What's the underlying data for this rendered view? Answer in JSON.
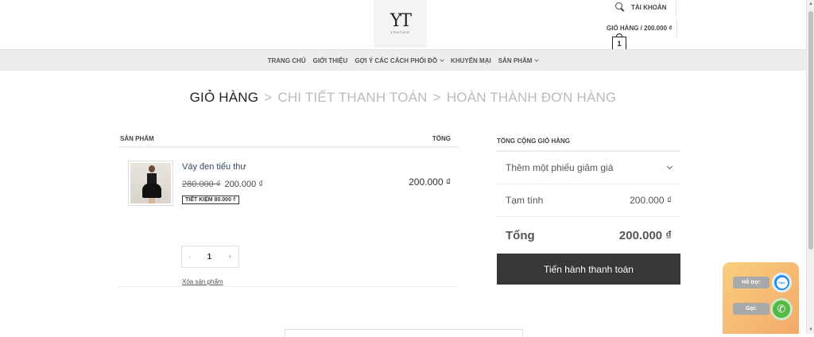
{
  "header": {
    "logo_mark": "YT",
    "logo_sub": "YOUTHIE",
    "account_label": "TÀI KHOẢN",
    "cart_label": "GIỎ HÀNG / 200.000 ₫",
    "cart_count": "1"
  },
  "nav": {
    "items": [
      {
        "label": "TRANG CHỦ"
      },
      {
        "label": "GIỚI THIỆU"
      },
      {
        "label": "GỢI Ý CÁC CÁCH PHỐI ĐỒ"
      },
      {
        "label": "KHUYẾN MẠI"
      },
      {
        "label": "SẢN PHẨM"
      }
    ]
  },
  "steps": {
    "cart": "GIỎ HÀNG",
    "checkout": "CHI TIẾT THANH TOÁN",
    "complete": "HOÀN THÀNH ĐƠN HÀNG",
    "separator": ">"
  },
  "cart": {
    "col_product": "SẢN PHẨM",
    "col_total": "TỔNG",
    "items": [
      {
        "name": "Váy đen tiểu thư",
        "old_price": "280.000 ₫",
        "price": "200.000 ₫",
        "saving": "TIẾT KIỆM 80.000 ₫",
        "line_total": "200.000 ₫",
        "quantity": "1",
        "minus": "-",
        "plus": "+",
        "remove": "Xóa sản phẩm"
      }
    ]
  },
  "totals": {
    "title": "TỔNG CỘNG GIỎ HÀNG",
    "coupon": "Thêm một phiếu giảm giá",
    "subtotal_label": "Tạm tính",
    "subtotal_value": "200.000 ₫",
    "total_label": "Tổng",
    "total_value": "200.000 ₫",
    "checkout_button": "Tiến hành thanh toán"
  },
  "support": {
    "zalo_label": "Hỗ trợ:",
    "zalo_icon_text": "Zalo",
    "call_label": "Gọi:"
  }
}
